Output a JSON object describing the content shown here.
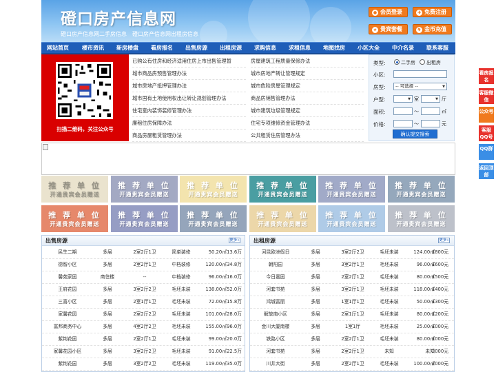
{
  "header": {
    "title": "磴口房产信息网",
    "subtitle": "磴口房产信息网二手房信息　磴口房产信息网出租房信息",
    "buttons": [
      {
        "label": "会员登录",
        "icon": "user-icon"
      },
      {
        "label": "免费注册",
        "icon": "register-icon"
      },
      {
        "label": "贵宾套餐",
        "icon": "vip-icon"
      },
      {
        "label": "金币充值",
        "icon": "coin-icon"
      }
    ]
  },
  "nav": [
    "网站首页",
    "楼市资讯",
    "新房楼盘",
    "看房报名",
    "出售房源",
    "出租房源",
    "求购信息",
    "求租信息",
    "地图找房",
    "小区大全",
    "中介名录",
    "联系客服"
  ],
  "qr": {
    "caption": "扫描二维码，关注公众号"
  },
  "news": {
    "left": [
      "已购公有住房和经济适用住房上市出售管理暂",
      "城市商品房预售管理办法",
      "城市房地产抵押管理办法",
      "城市国有土地使用权出让转让规划管理办法",
      "住宅室内装饰装修管理办法",
      "廉租住房保障办法",
      "商品房屋租赁管理办法"
    ],
    "right": [
      "房屋建筑工程质量保修办法",
      "城市房地产转让管理规定",
      "城市危险房屋管理规定",
      "商品房销售管理办法",
      "城市建筑垃圾管理规定",
      "住宅专项维修资金管理办法",
      "公共租赁住房管理办法"
    ]
  },
  "search": {
    "type_label": "类型:",
    "type_options": [
      "二手房",
      "出租房"
    ],
    "community_label": "小区:",
    "housetype_label": "房型:",
    "housetype_value": "-- 可选择 --",
    "layout_label": "户型:",
    "room_unit": "室",
    "hall_unit": "厅",
    "area_label": "面积:",
    "area_unit": "㎡",
    "range_sep": "〜",
    "price_label": "价格:",
    "price_unit": "元",
    "submit": "确认提交搜索"
  },
  "ad_slots": {
    "title": "推 荐 单 位",
    "sub": "开通贵宾会员赠送"
  },
  "sale": {
    "title": "出售房源",
    "more": "更多»",
    "rows": [
      [
        "民生二期",
        "多层",
        "2室2厅1卫",
        "简单装修",
        "50.20㎡",
        "13.6万"
      ],
      [
        "德智小区",
        "多层",
        "2室2厅1卫",
        "中档装修",
        "120.00㎡",
        "34.8万"
      ],
      [
        "馨苑家园",
        "商住楼",
        "--",
        "中档装修",
        "96.00㎡",
        "16.0万"
      ],
      [
        "王府花园",
        "多层",
        "3室2厅2卫",
        "毛坯未装",
        "138.00㎡",
        "52.0万"
      ],
      [
        "三喜小区",
        "多层",
        "2室1厅1卫",
        "毛坯未装",
        "72.00㎡",
        "15.8万"
      ],
      [
        "家馨花园",
        "多层",
        "2室2厅2卫",
        "毛坯未装",
        "101.00㎡",
        "28.0万"
      ],
      [
        "富邦商务中心",
        "多层",
        "4室2厅2卫",
        "毛坯未装",
        "155.00㎡",
        "96.0万"
      ],
      [
        "紫荆花园",
        "多层",
        "2室2厅1卫",
        "毛坯未装",
        "99.00㎡",
        "20.0万"
      ],
      [
        "家馨花园小区",
        "多层",
        "3室2厅2卫",
        "毛坯未装",
        "91.00㎡",
        "22.5万"
      ],
      [
        "紫荆花园",
        "多层",
        "3室2厅2卫",
        "毛坯未装",
        "119.00㎡",
        "35.0万"
      ]
    ]
  },
  "rent": {
    "title": "出租房源",
    "more": "更多»",
    "rows": [
      [
        "河昆欧洲假日",
        "多层",
        "3室2厅2卫",
        "毛坯未装",
        "124.00㎡",
        "1800元"
      ],
      [
        "朝阳园",
        "多层",
        "3室2厅1卫",
        "毛坯未装",
        "96.00㎡",
        "1600元"
      ],
      [
        "今日嘉园",
        "多层",
        "2室2厅1卫",
        "毛坯未装",
        "80.00㎡",
        "1500元"
      ],
      [
        "河套书苑",
        "多层",
        "3室2厅1卫",
        "毛坯未装",
        "118.00㎡",
        "1400元"
      ],
      [
        "鸿城富丽",
        "多层",
        "1室1厅1卫",
        "毛坯未装",
        "50.00㎡",
        "1300元"
      ],
      [
        "解放南小区",
        "多层",
        "2室1厅1卫",
        "毛坯未装",
        "80.00㎡",
        "1200元"
      ],
      [
        "金川大厦南楼",
        "多层",
        "1室1厅",
        "毛坯未装",
        "25.00㎡",
        "1000元"
      ],
      [
        "铁路小区",
        "多层",
        "2室2厅1卫",
        "毛坯未装",
        "80.00㎡",
        "1000元"
      ],
      [
        "河套书苑",
        "多层",
        "2室2厅1卫",
        "未知",
        "未知",
        "2000元"
      ],
      [
        "川井大街",
        "多层",
        "2室2厅1卫",
        "毛坯未装",
        "100.00㎡",
        "2000元"
      ]
    ]
  },
  "side": [
    "看房报名",
    "客服微信",
    "公众号",
    "客服QQ号",
    "QQ群",
    "返回顶部"
  ]
}
